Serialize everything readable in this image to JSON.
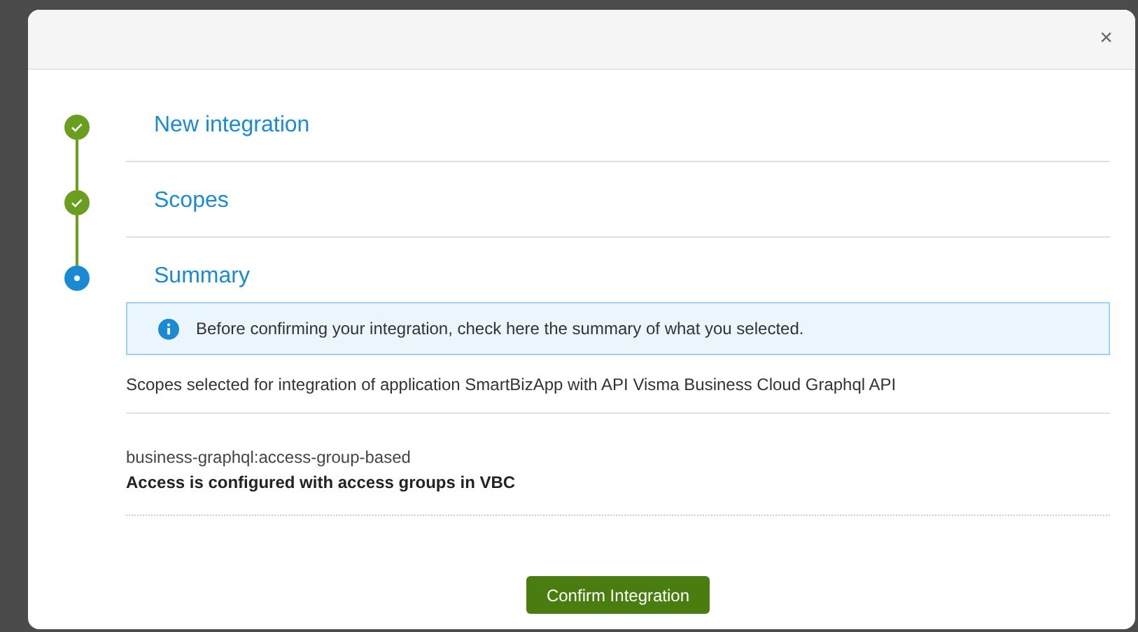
{
  "dialog": {
    "close": "×"
  },
  "steps": [
    {
      "title": "New integration",
      "completed": true,
      "selected": false
    },
    {
      "title": "Scopes",
      "completed": true,
      "selected": false
    },
    {
      "title": "Summary",
      "completed": false,
      "selected": true
    }
  ],
  "info": "Before confirming your integration, check here the summary of what you selected.",
  "scopes_heading": "Scopes selected for integration of application SmartBizApp with API Visma Business Cloud Graphql API",
  "scopes": [
    {
      "name": "business-graphql:access-group-based",
      "description": "Access is configured with access groups in VBC"
    }
  ],
  "confirm_button": "Confirm Integration"
}
